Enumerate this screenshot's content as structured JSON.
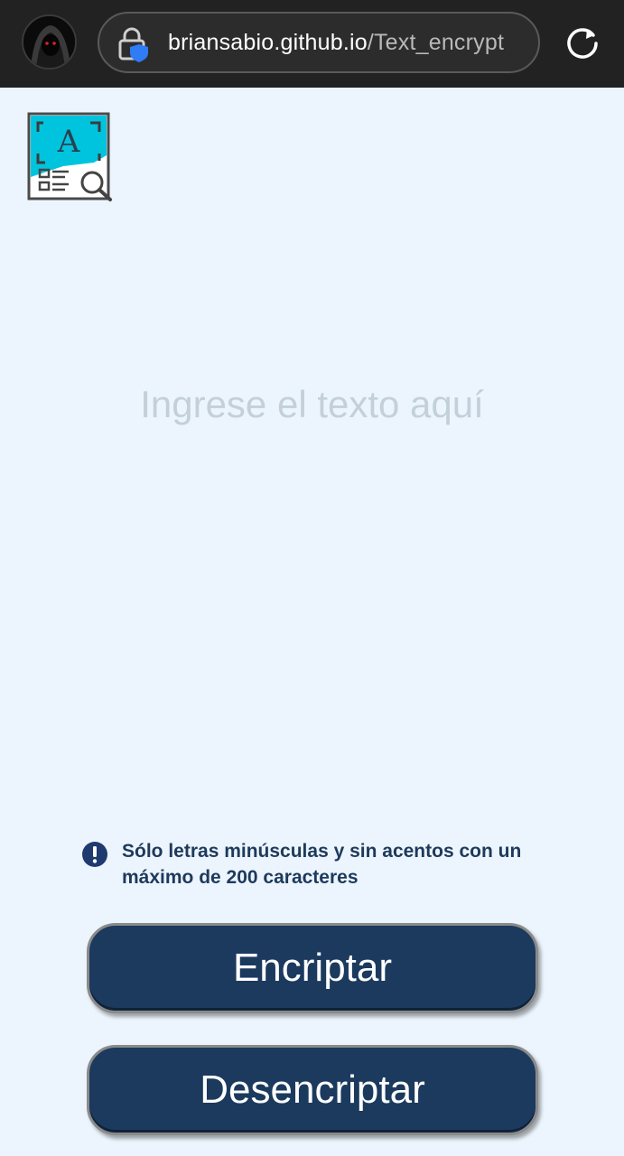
{
  "browser": {
    "url_host": "briansabio.github.io",
    "url_path": "/Text_encrypt",
    "avatar_icon": "hooded-figure-avatar",
    "security_icon": "lock-shield-icon",
    "reload_icon": "reload-icon"
  },
  "app": {
    "logo_icon": "text-scan-search-icon",
    "input": {
      "placeholder": "Ingrese el texto aquí",
      "value": ""
    },
    "info": {
      "icon": "exclamation-circle-icon",
      "text": "Sólo letras minúsculas y sin acentos con un máximo de 200 caracteres"
    },
    "buttons": {
      "encrypt": "Encriptar",
      "decrypt": "Desencriptar"
    },
    "colors": {
      "background": "#ecf5fd",
      "button": "#1b3a5e",
      "accent": "#00b8d4",
      "placeholder": "#c3d0da",
      "info_text": "#1e3a5c"
    }
  }
}
